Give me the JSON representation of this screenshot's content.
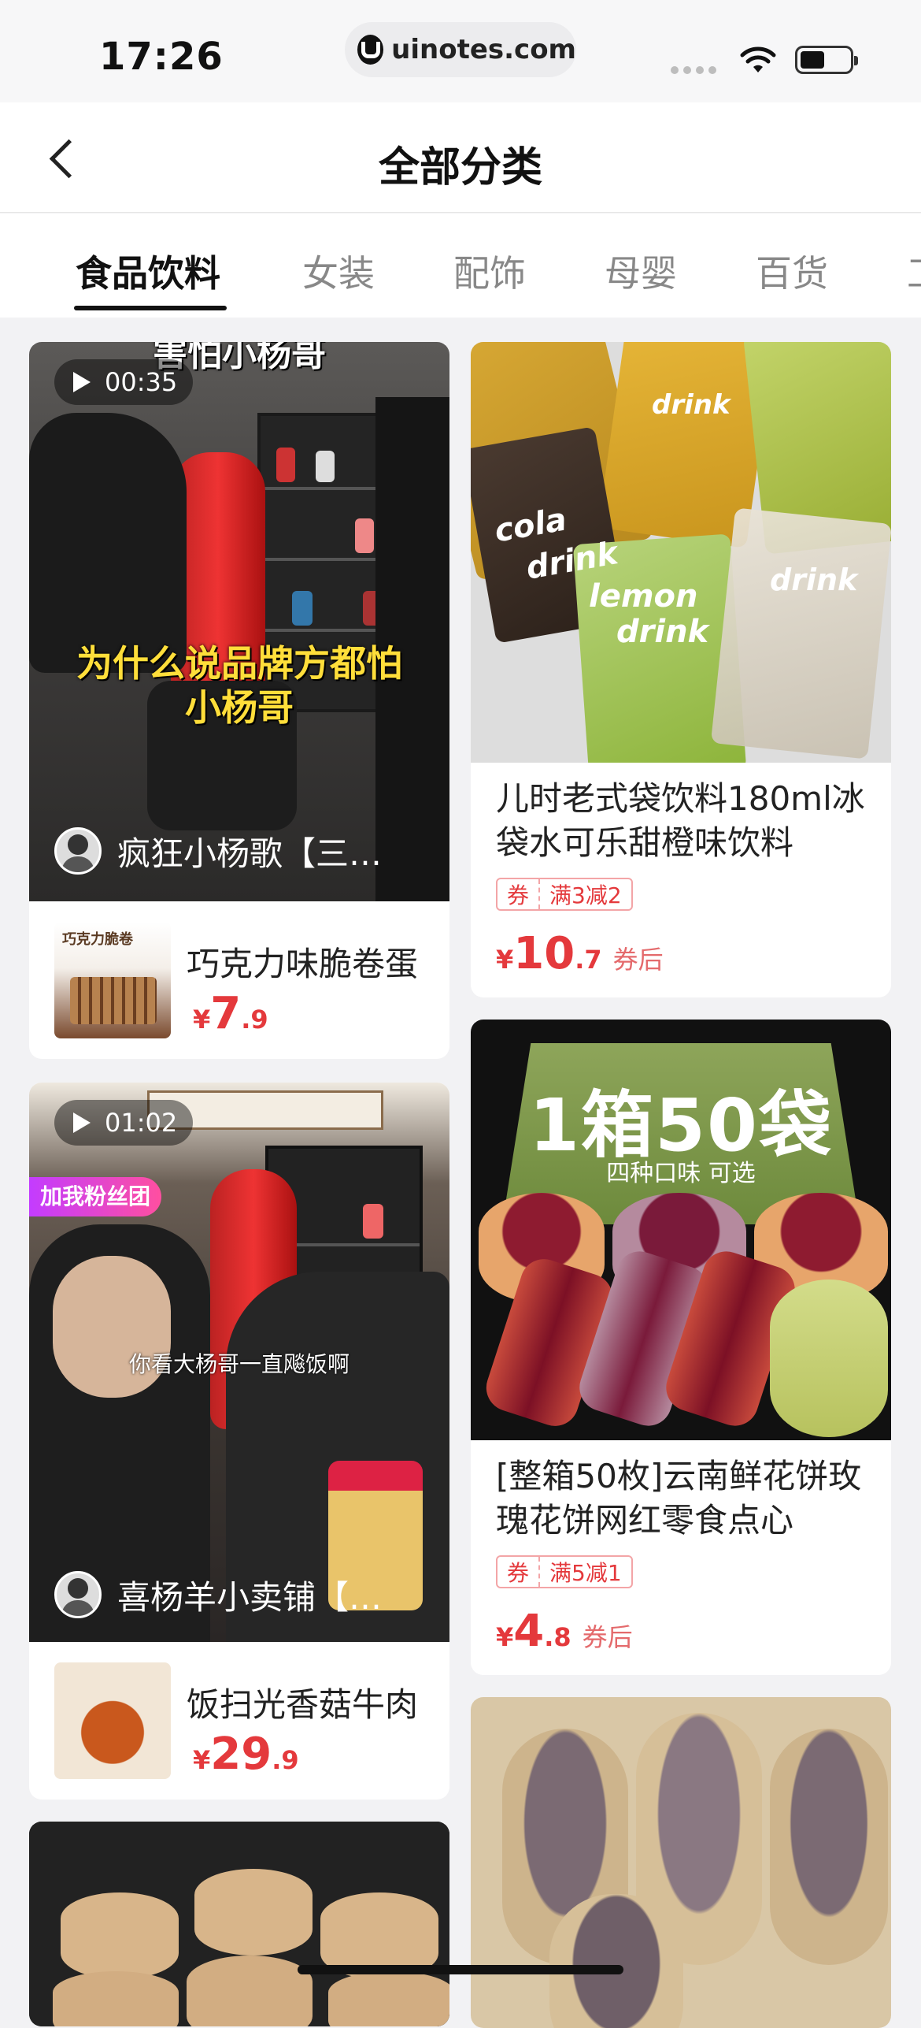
{
  "status_bar": {
    "time": "17:26",
    "url": "uinotes.com"
  },
  "nav": {
    "title": "全部分类"
  },
  "tabs": [
    {
      "label": "食品饮料",
      "active": true
    },
    {
      "label": "女装",
      "active": false
    },
    {
      "label": "配饰",
      "active": false
    },
    {
      "label": "母婴",
      "active": false
    },
    {
      "label": "百货",
      "active": false
    },
    {
      "label": "工",
      "active": false
    }
  ],
  "left_column": [
    {
      "duration": "00:35",
      "caption_top": "害怕小杨哥",
      "caption": "为什么说品牌方都怕\n小杨哥",
      "author": "疯狂小杨歌【三…",
      "product_name": "巧克力味脆卷蛋",
      "price_symbol": "¥",
      "price_int": "7",
      "price_dec": ".9"
    },
    {
      "duration": "01:02",
      "badge": "加我粉丝团",
      "caption": "你看大杨哥一直飚饭啊",
      "author": "喜杨羊小卖铺【…",
      "product_name": "饭扫光香菇牛肉",
      "price_symbol": "¥",
      "price_int": "29",
      "price_dec": ".9"
    }
  ],
  "right_column": [
    {
      "title": "儿时老式袋饮料180ml冰袋水可乐甜橙味饮料",
      "coupon_tag": "券",
      "coupon_rule": "满3减2",
      "price_symbol": "¥",
      "price_int": "10",
      "price_dec": ".7",
      "price_suffix": "券后"
    },
    {
      "image_text_main": "1箱50袋",
      "image_text_sub": "四种口味  可选",
      "title": "[整箱50枚]云南鲜花饼玫瑰花饼网红零食点心",
      "coupon_tag": "券",
      "coupon_rule": "满5减1",
      "price_symbol": "¥",
      "price_int": "4",
      "price_dec": ".8",
      "price_suffix": "券后"
    }
  ],
  "image_text": {
    "drink_label": "drink",
    "lemon_label": "lemon",
    "cola_label": "cola",
    "mini_box": "巧克力脆卷"
  },
  "colors": {
    "price_red": "#e4393c",
    "tab_active": "#111111",
    "tab_inactive": "#888888"
  }
}
